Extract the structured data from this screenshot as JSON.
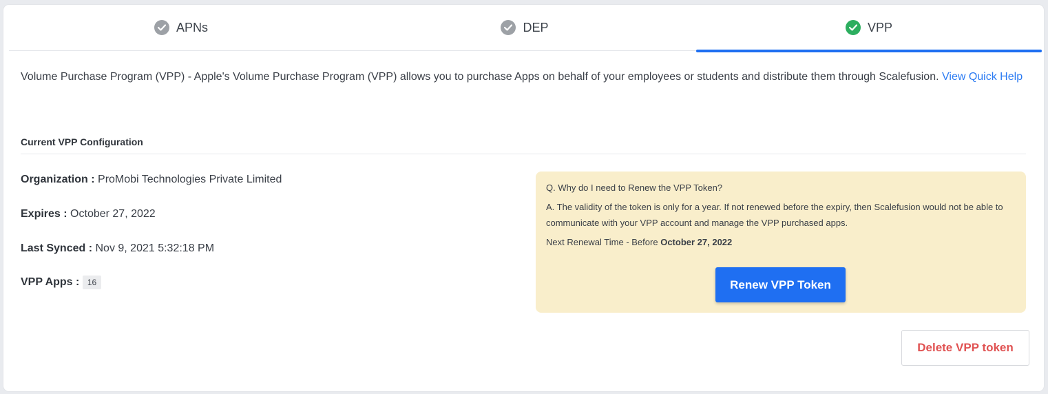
{
  "tabs": [
    {
      "label": "APNs",
      "status": "configured"
    },
    {
      "label": "DEP",
      "status": "configured"
    },
    {
      "label": "VPP",
      "status": "active"
    }
  ],
  "description": {
    "text": "Volume Purchase Program (VPP) - Apple's Volume Purchase Program (VPP) allows you to purchase Apps on behalf of your employees or students and distribute them through Scalefusion.",
    "link": "View Quick Help"
  },
  "section_title": "Current VPP Configuration",
  "config": {
    "organization_label": "Organization :",
    "organization_value": "ProMobi Technologies Private Limited",
    "expires_label": "Expires :",
    "expires_value": "October 27, 2022",
    "synced_label": "Last Synced :",
    "synced_value": "Nov 9, 2021 5:32:18 PM",
    "apps_label": "VPP Apps :",
    "apps_count": "16"
  },
  "faq": {
    "question": "Q. Why do I need to Renew the VPP Token?",
    "answer": "A. The validity of the token is only for a year. If not renewed before the expiry, then Scalefusion would not be able to communicate with your VPP account and manage the VPP purchased apps.",
    "renewal_prefix": "Next Renewal Time - Before",
    "renewal_date": "October 27, 2022"
  },
  "buttons": {
    "renew": "Renew VPP Token",
    "delete": "Delete VPP token"
  },
  "colors": {
    "accent": "#1f6ff2",
    "success": "#2cae5f",
    "danger": "#e05252",
    "faq_bg": "#f9eecb"
  }
}
